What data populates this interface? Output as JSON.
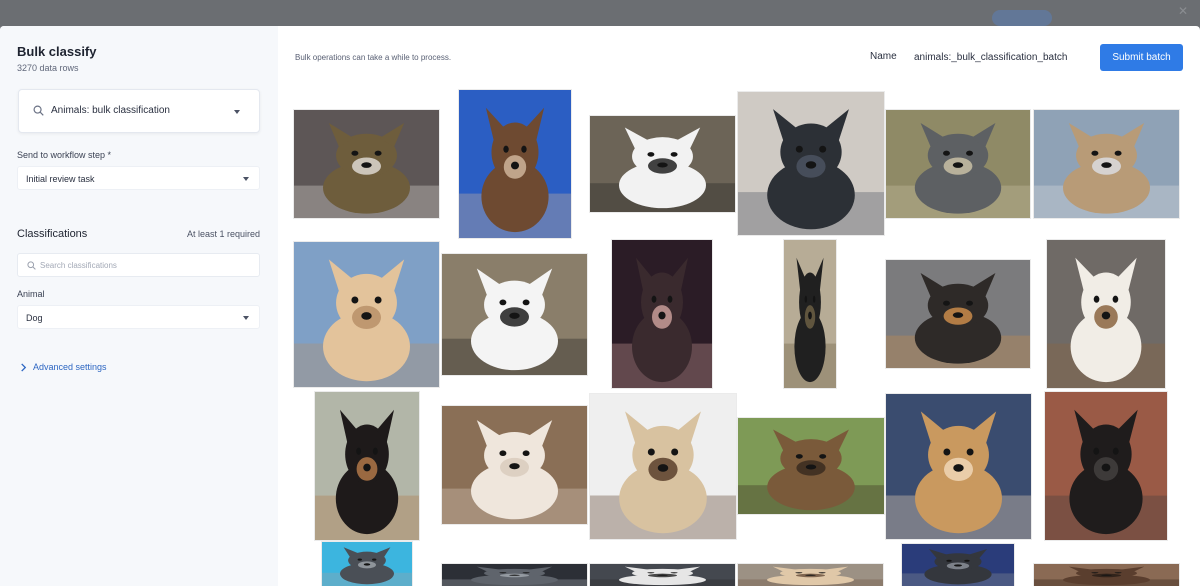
{
  "modal": {
    "title": "Bulk classify",
    "row_count": "3270 data rows",
    "project_select": {
      "value": "Animals: bulk classification",
      "icon": "search-icon"
    },
    "workflow": {
      "label": "Send to workflow step *",
      "value": "Initial review task"
    },
    "classifications": {
      "title": "Classifications",
      "hint": "At least 1 required",
      "search_placeholder": "Search classifications",
      "field_label": "Animal",
      "field_value": "Dog"
    },
    "advanced_label": "Advanced settings",
    "note": "Bulk operations can take a while to process.",
    "name_label": "Name",
    "name_value": "animals:_bulk_classification_batch",
    "submit_label": "Submit batch"
  },
  "colors": {
    "accent": "#2f7be6",
    "link": "#2d66c2",
    "sidebar_bg": "#f6f8fb",
    "backdrop": "#6f7276"
  },
  "gallery": {
    "image_count_visible": 24,
    "images": [
      {
        "bg": "#5d5656",
        "fg": "#6e5d3c",
        "acc": "#ddd7d0"
      },
      {
        "bg": "#2b5ec3",
        "fg": "#6e4a31",
        "acc": "#cfb49a"
      },
      {
        "bg": "#6c6457",
        "fg": "#f2f2f2",
        "acc": "#222222"
      },
      {
        "bg": "#cfcac4",
        "fg": "#2c3036",
        "acc": "#4b5260"
      },
      {
        "bg": "#8f8a66",
        "fg": "#5d6063",
        "acc": "#c8c0a4"
      },
      {
        "bg": "#8fa2b6",
        "fg": "#b89b77",
        "acc": "#dadcdf"
      },
      {
        "bg": "#7fa0c6",
        "fg": "#e3c39b",
        "acc": "#b89068"
      },
      {
        "bg": "#8a7e6a",
        "fg": "#f4f4f4",
        "acc": "#1f1f1f"
      },
      {
        "bg": "#2b1c26",
        "fg": "#3a2a2e",
        "acc": "#c89c98"
      },
      {
        "bg": "#b7ac96",
        "fg": "#202020",
        "acc": "#6c5f44"
      },
      {
        "bg": "#7b7b7d",
        "fg": "#2e2a28",
        "acc": "#c98b4a"
      },
      {
        "bg": "#6f6a66",
        "fg": "#f1ede6",
        "acc": "#8b6440"
      },
      {
        "bg": "#b2b6a8",
        "fg": "#1e1a1a",
        "acc": "#b07849"
      },
      {
        "bg": "#8a6f56",
        "fg": "#efe6dc",
        "acc": "#d9cbbd"
      },
      {
        "bg": "#efefef",
        "fg": "#d8c2a0",
        "acc": "#5b3f2b"
      },
      {
        "bg": "#7e9a56",
        "fg": "#7a5a3a",
        "acc": "#3a2c20"
      },
      {
        "bg": "#3a4c6f",
        "fg": "#c9995f",
        "acc": "#f0d6b6"
      },
      {
        "bg": "#9a5a46",
        "fg": "#1f1c1c",
        "acc": "#43403e"
      },
      {
        "bg": "#3cb5df",
        "fg": "#4a4f56",
        "acc": "#9aa0a6"
      },
      {
        "bg": "#2c2f36",
        "fg": "#5f646c",
        "acc": "#9ea3aa"
      },
      {
        "bg": "#44484f",
        "fg": "#e6e6e6",
        "acc": "#2a2a2a"
      },
      {
        "bg": "#9c9184",
        "fg": "#e0c8a8",
        "acc": "#6d5340"
      },
      {
        "bg": "#2a3c7a",
        "fg": "#34373d",
        "acc": "#8a8e96"
      },
      {
        "bg": "#8a6a54",
        "fg": "#5a3e2e",
        "acc": "#2a1e18"
      }
    ]
  }
}
